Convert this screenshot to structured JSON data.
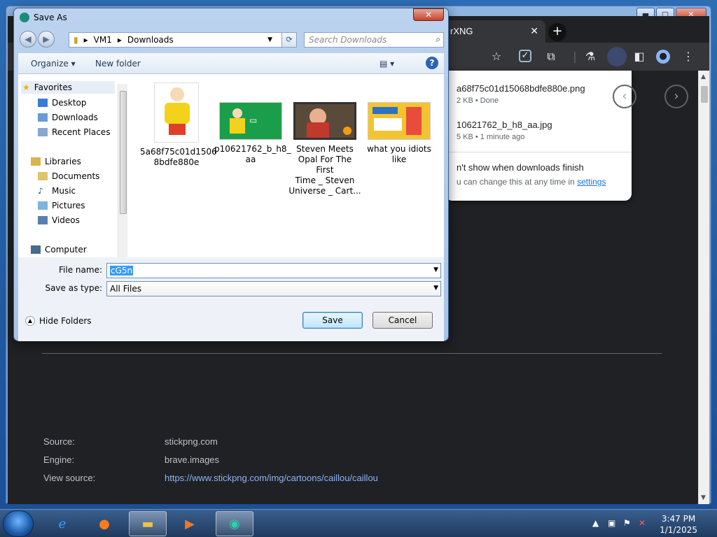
{
  "browser": {
    "tab_title": "rXNG",
    "tab_close": "✕",
    "new_tab": "+",
    "win_min": "▬",
    "win_max": "▢",
    "win_close": "✕"
  },
  "downloads_popup": {
    "items": [
      {
        "name": "a68f75c01d15068bdfe880e.png",
        "meta": "2 KB • Done"
      },
      {
        "name": "10621762_b_h8_aa.jpg",
        "meta": "5 KB • 1 minute ago"
      }
    ],
    "dont_show": "n't show when downloads finish",
    "change_text": "u can change this at any time in",
    "settings_link": "settings"
  },
  "page_meta": {
    "source_label": "Source:",
    "source_value": "stickpng.com",
    "engine_label": "Engine:",
    "engine_value": "brave.images",
    "view_label": "View source:",
    "view_value": "https://www.stickpng.com/img/cartoons/caillou/caillou"
  },
  "dialog": {
    "title": "Save As",
    "close": "✕",
    "breadcrumb": [
      "VM1",
      "Downloads"
    ],
    "search_placeholder": "Search Downloads",
    "organize": "Organize ▾",
    "new_folder": "New folder",
    "help": "?",
    "nav": {
      "favorites": "Favorites",
      "desktop": "Desktop",
      "downloads": "Downloads",
      "recent": "Recent Places",
      "libraries": "Libraries",
      "documents": "Documents",
      "music": "Music",
      "pictures": "Pictures",
      "videos": "Videos",
      "computer": "Computer"
    },
    "files": [
      {
        "name": "5a68f75c01d1506\n8bdfe880e"
      },
      {
        "name": "p10621762_b_h8_\naa"
      },
      {
        "name": "Steven Meets\nOpal For The First\nTime _ Steven\nUniverse _ Cart..."
      },
      {
        "name": "what you idiots\nlike"
      }
    ],
    "file_name_label": "File name:",
    "file_name_value": "cG5n",
    "save_type_label": "Save as type:",
    "save_type_value": "All Files",
    "hide_folders": "Hide Folders",
    "save_btn": "Save",
    "cancel_btn": "Cancel"
  },
  "taskbar": {
    "time": "3:47 PM",
    "date": "1/1/2025"
  }
}
